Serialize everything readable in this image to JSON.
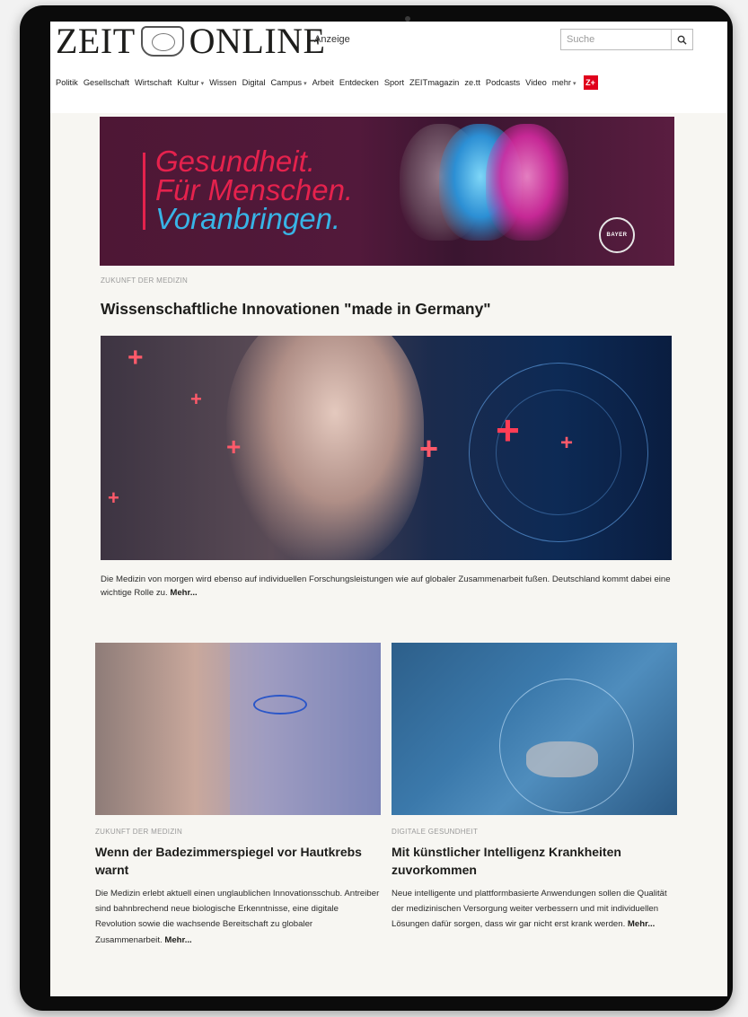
{
  "site": {
    "logo_left": "ZEIT",
    "logo_right": "ONLINE",
    "anzeige_label": "Anzeige",
    "search_placeholder": "Suche"
  },
  "nav": {
    "items": [
      {
        "label": "Politik",
        "dropdown": false
      },
      {
        "label": "Gesellschaft",
        "dropdown": false
      },
      {
        "label": "Wirtschaft",
        "dropdown": false
      },
      {
        "label": "Kultur",
        "dropdown": true
      },
      {
        "label": "Wissen",
        "dropdown": false
      },
      {
        "label": "Digital",
        "dropdown": false
      },
      {
        "label": "Campus",
        "dropdown": true
      },
      {
        "label": "Arbeit",
        "dropdown": false
      },
      {
        "label": "Entdecken",
        "dropdown": false
      },
      {
        "label": "Sport",
        "dropdown": false
      },
      {
        "label": "ZEITmagazin",
        "dropdown": false
      },
      {
        "label": "ze.tt",
        "dropdown": false
      },
      {
        "label": "Podcasts",
        "dropdown": false
      },
      {
        "label": "Video",
        "dropdown": false
      },
      {
        "label": "mehr",
        "dropdown": true
      }
    ],
    "zplus_label": "Z+"
  },
  "banner": {
    "line1": "Gesundheit.",
    "line2": "Für Menschen.",
    "line3": "Voranbringen.",
    "brand_mark": "BAYER",
    "colors": {
      "primary": "#e5224d",
      "secondary": "#38b4e6",
      "background": "#4e1735"
    }
  },
  "main_article": {
    "kicker": "ZUKUNFT DER MEDIZIN",
    "title": "Wissenschaftliche Innovationen \"made in Germany\"",
    "teaser": "Die Medizin von morgen wird ebenso auf individuellen Forschungsleistungen wie auf globaler Zusammenarbeit fußen. Deutschland kommt dabei eine wichtige Rolle zu.",
    "more_label": "Mehr..."
  },
  "cards": [
    {
      "kicker": "ZUKUNFT DER MEDIZIN",
      "title": "Wenn der Badezimmerspiegel vor Hautkrebs warnt",
      "teaser": "Die Medizin erlebt aktuell einen unglaublichen Innovationsschub. Antreiber sind bahnbrechend neue biologische Erkenntnisse, eine digitale Revolution sowie die wachsende Bereitschaft zu globaler Zusammenarbeit.",
      "more_label": "Mehr..."
    },
    {
      "kicker": "DIGITALE GESUNDHEIT",
      "title": "Mit künstlicher Intelligenz Krankheiten zuvorkommen",
      "teaser": "Neue intelligente und plattformbasierte Anwendungen sollen die Qualität der medizinischen Versorgung weiter verbessern und mit individuellen Lösungen dafür sorgen, dass wir gar nicht erst krank werden.",
      "more_label": "Mehr..."
    }
  ]
}
